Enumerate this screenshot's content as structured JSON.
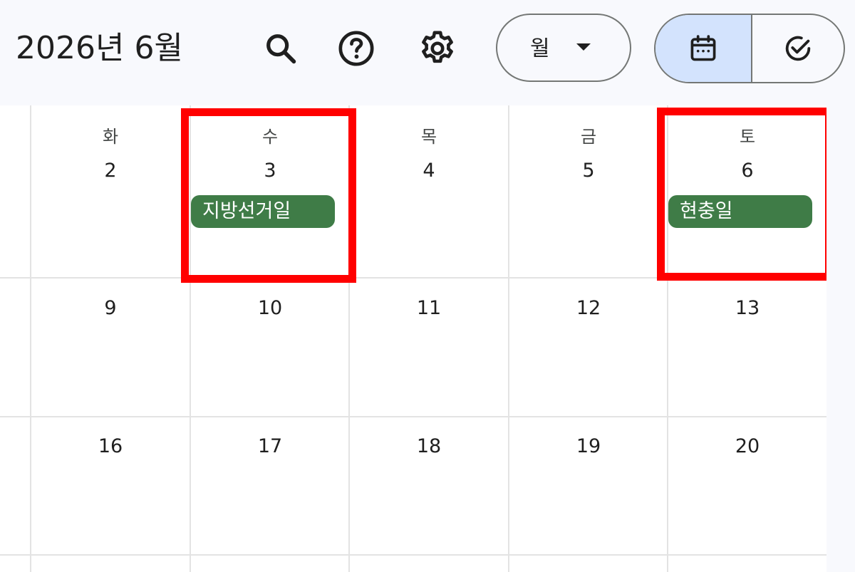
{
  "header": {
    "title": "2026년 6월",
    "icons": {
      "search": "search-icon",
      "help": "help-icon",
      "settings": "gear-icon",
      "dropdown": "caret-down-icon",
      "calendar_view": "calendar-icon",
      "tasks_view": "task-check-icon"
    },
    "view_select_label": "월"
  },
  "calendar": {
    "weekdays": [
      "화",
      "수",
      "목",
      "금",
      "토"
    ],
    "weeks": [
      [
        "2",
        "3",
        "4",
        "5",
        "6"
      ],
      [
        "9",
        "10",
        "11",
        "12",
        "13"
      ],
      [
        "16",
        "17",
        "18",
        "19",
        "20"
      ]
    ],
    "events": [
      {
        "label": "지방선거일",
        "day": "3",
        "color": "#3f7c47"
      },
      {
        "label": "현충일",
        "day": "6",
        "color": "#3f7c47"
      }
    ]
  },
  "colors": {
    "accent_selected": "#d3e3fd",
    "highlight_box": "#ff0000",
    "event_green": "#3f7c47"
  }
}
